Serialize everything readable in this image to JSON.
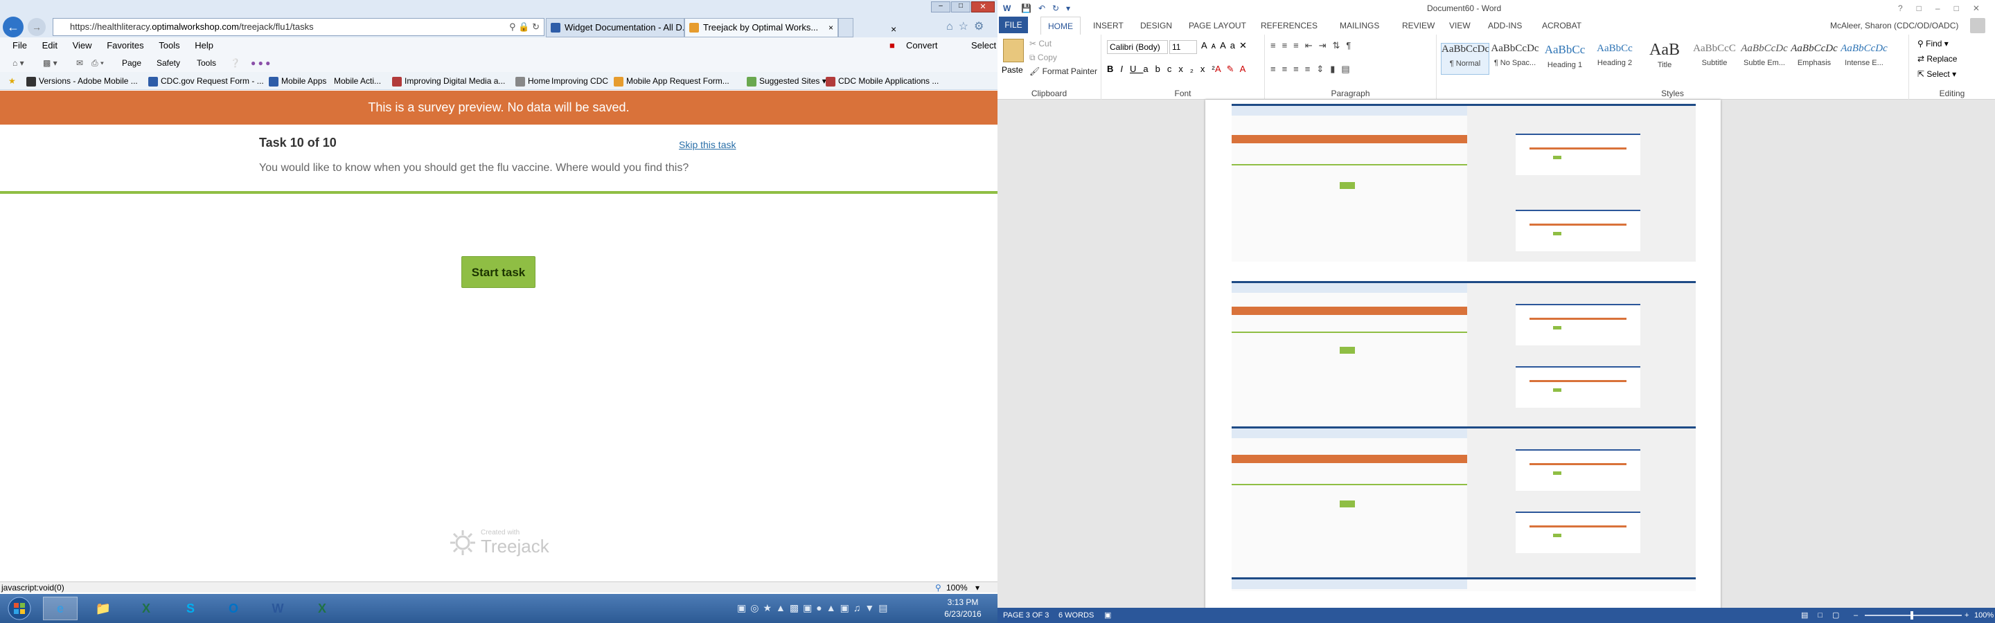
{
  "browser": {
    "url_prefix": "https://healthliteracy.",
    "url_domain": "optimalworkshop.com",
    "url_path": "/treejack/flu1/tasks",
    "tabs": [
      {
        "label": "Widget Documentation - All D..."
      },
      {
        "label": "Treejack by Optimal Works..."
      }
    ],
    "convert_label": "Convert",
    "select_label": "Select",
    "menu": [
      "File",
      "Edit",
      "View",
      "Favorites",
      "Tools",
      "Help"
    ],
    "cmd": {
      "page": "Page",
      "safety": "Safety",
      "tools": "Tools"
    },
    "favorites": [
      "Versions - Adobe Mobile ...",
      "CDC.gov Request Form - ...",
      "Mobile Apps",
      "Mobile Acti...",
      "Improving Digital Media a...",
      "Home",
      "Improving CDC",
      "Mobile App Request Form...",
      "Suggested Sites",
      "CDC Mobile Applications ..."
    ],
    "status_text": "javascript:void(0)",
    "zoom": "100%"
  },
  "survey": {
    "banner": "This is a survey preview. No data will be saved.",
    "task_heading": "Task 10 of 10",
    "skip_label": "Skip this task",
    "task_text": "You would like to know when you should get the flu vaccine. Where would you find this?",
    "start_label": "Start task",
    "created_with": "Created with",
    "brand": "Treejack"
  },
  "taskbar": {
    "time": "3:13 PM",
    "date": "6/23/2016"
  },
  "word": {
    "title": "Document60 - Word",
    "user": "McAleer, Sharon (CDC/OD/OADC)",
    "tabs": [
      "FILE",
      "HOME",
      "INSERT",
      "DESIGN",
      "PAGE LAYOUT",
      "REFERENCES",
      "MAILINGS",
      "REVIEW",
      "VIEW",
      "ADD-INS",
      "ACROBAT"
    ],
    "clipboard": {
      "paste": "Paste",
      "cut": "Cut",
      "copy": "Copy",
      "format_painter": "Format Painter",
      "label": "Clipboard"
    },
    "font": {
      "name": "Calibri (Body)",
      "size": "11",
      "label": "Font"
    },
    "paragraph_label": "Paragraph",
    "styles_label": "Styles",
    "editing": {
      "find": "Find",
      "replace": "Replace",
      "select": "Select",
      "label": "Editing"
    },
    "styles": [
      {
        "preview": "AaBbCcDc",
        "label": "¶ Normal"
      },
      {
        "preview": "AaBbCcDc",
        "label": "¶ No Spac..."
      },
      {
        "preview": "AaBbCc",
        "label": "Heading 1"
      },
      {
        "preview": "AaBbCc",
        "label": "Heading 2"
      },
      {
        "preview": "AaB",
        "label": "Title"
      },
      {
        "preview": "AaBbCcC",
        "label": "Subtitle"
      },
      {
        "preview": "AaBbCcDc",
        "label": "Subtle Em..."
      },
      {
        "preview": "AaBbCcDc",
        "label": "Emphasis"
      },
      {
        "preview": "AaBbCcDc",
        "label": "Intense E..."
      }
    ],
    "status": {
      "page": "PAGE 3 OF 3",
      "words": "6 WORDS",
      "zoom": "100%"
    }
  },
  "colors": {
    "banner": "#d9723a",
    "accent_green": "#8fbe44",
    "word_blue": "#2b579a"
  }
}
